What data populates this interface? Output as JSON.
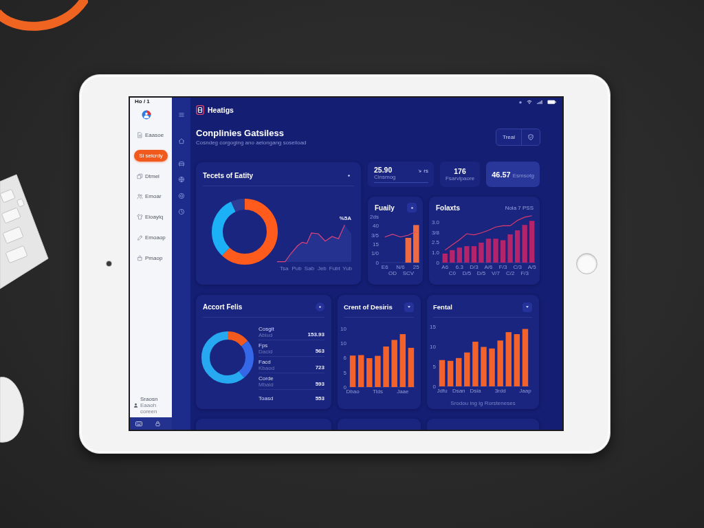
{
  "sidebar": {
    "status_text": "Ho / 1",
    "items": [
      {
        "label": "Eaasoe",
        "selected": false
      },
      {
        "label": "Si seicrdy",
        "selected": true
      },
      {
        "label": "Dtmel",
        "selected": false
      },
      {
        "label": "Emoar",
        "selected": false
      },
      {
        "label": "Eioayiq",
        "selected": false
      },
      {
        "label": "Emoaop",
        "selected": false
      },
      {
        "label": "Pmaop",
        "selected": false
      }
    ],
    "user": {
      "name": "Sraosn",
      "detail": "Eaaoh coreen"
    }
  },
  "header": {
    "app_name": "Heatigs",
    "title": "Conplinies Gatsiless",
    "subtitle": "Cosndeg corgoging ano aeiongang soseiload",
    "button_label": "Treal"
  },
  "overview": {
    "title": "Tecets of Eatity",
    "line_label": "%5A",
    "x_labels": [
      "Tsa",
      "Pub",
      "Sab",
      "Jeb",
      "Fubt",
      "Yub"
    ]
  },
  "stats": [
    {
      "value": "25.90",
      "label": "Cinsmog",
      "trend": "rs",
      "selected": false
    },
    {
      "value": "176",
      "label": "Fsarvlpaore",
      "selected": false
    },
    {
      "value": "46.57",
      "label": "Esmsotg",
      "selected": true
    }
  ],
  "small_charts": [
    {
      "title": "Fuaily",
      "y_axis_labels": [
        "2ds",
        "40",
        "3/5",
        "15",
        "1/0",
        "0"
      ],
      "x_axis_labels": [
        "E6",
        "OD",
        "N/6",
        "SCV",
        "25"
      ]
    },
    {
      "title": "Folaxts",
      "legend": "Nola 7 PSS",
      "y_axis_labels": [
        "3.0",
        "3/8",
        "2.5",
        "1.0",
        "0"
      ],
      "x_axis_labels": [
        "A6",
        "C0",
        "6.3",
        "D/5",
        "D/3",
        "D/5",
        "A/6",
        "V/7",
        "F/3",
        "C/2",
        "C/3",
        "F/3",
        "A/5"
      ]
    }
  ],
  "breakdown": {
    "title": "Accort Felis",
    "rows": [
      {
        "name": "Cosgit",
        "detail": "Abiud",
        "value": "153.93"
      },
      {
        "name": "Fps",
        "detail": "Dacid",
        "value": "563"
      },
      {
        "name": "Facd",
        "detail": "Kbaod",
        "value": "723"
      },
      {
        "name": "Corde",
        "detail": "Mbaid",
        "value": "593"
      },
      {
        "name": "Toasd",
        "value": "553"
      }
    ]
  },
  "bar_cards": [
    {
      "title": "Crent of Desiris",
      "y_axis_labels": [
        "10",
        "10",
        "6",
        "5",
        "0"
      ],
      "x_axis_labels": [
        "Dbao",
        "Tlds",
        "Jaae"
      ]
    },
    {
      "title": "Fental",
      "chart_data": {
        "type": "bar",
        "xlabel": "Srodou ing ig Rorsteneses",
        "categories": [
          "Jdfu",
          null,
          "Dsan",
          null,
          "Dsia",
          null,
          null,
          "3rdd",
          null,
          null,
          "Jaap"
        ],
        "series": [
          {
            "color": "#f2622a",
            "values": [
              6.6,
              6.4,
              7.1,
              8.5,
              11.2,
              9.9,
              9.5,
              11.5,
              13.6,
              13.1,
              14.4
            ]
          }
        ],
        "ylim": [
          0,
          15
        ],
        "yticks": [
          0,
          5,
          10,
          15
        ]
      }
    }
  ]
}
